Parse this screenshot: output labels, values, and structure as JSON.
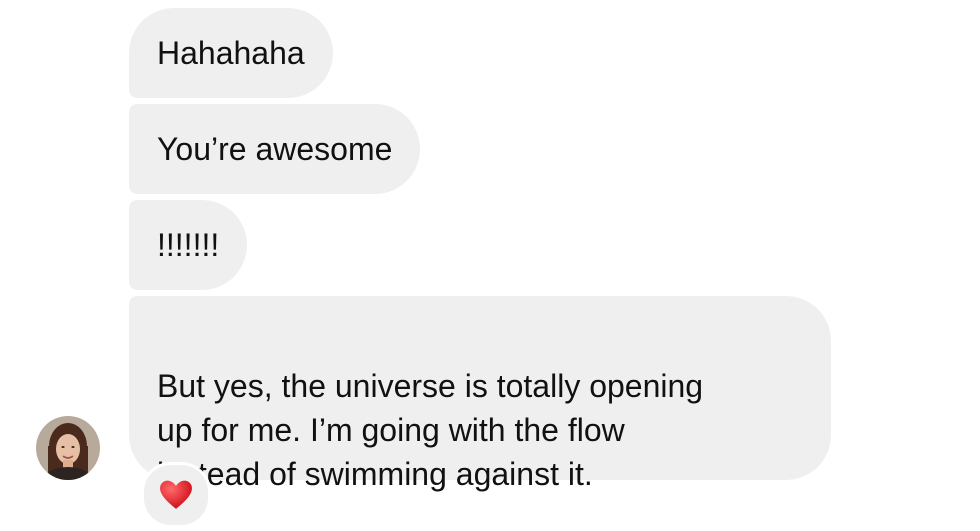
{
  "messages": [
    {
      "text": "Hahahaha"
    },
    {
      "text": "You’re awesome"
    },
    {
      "text": "!!!!!!!"
    },
    {
      "text": "But yes, the universe is totally opening\nup for me. I’m going with the flow\ninstead of swimming against it."
    }
  ],
  "reaction": {
    "icon": "heart-icon",
    "color": "#e0141e"
  },
  "colors": {
    "bubble": "#efefef",
    "text": "#111111"
  }
}
